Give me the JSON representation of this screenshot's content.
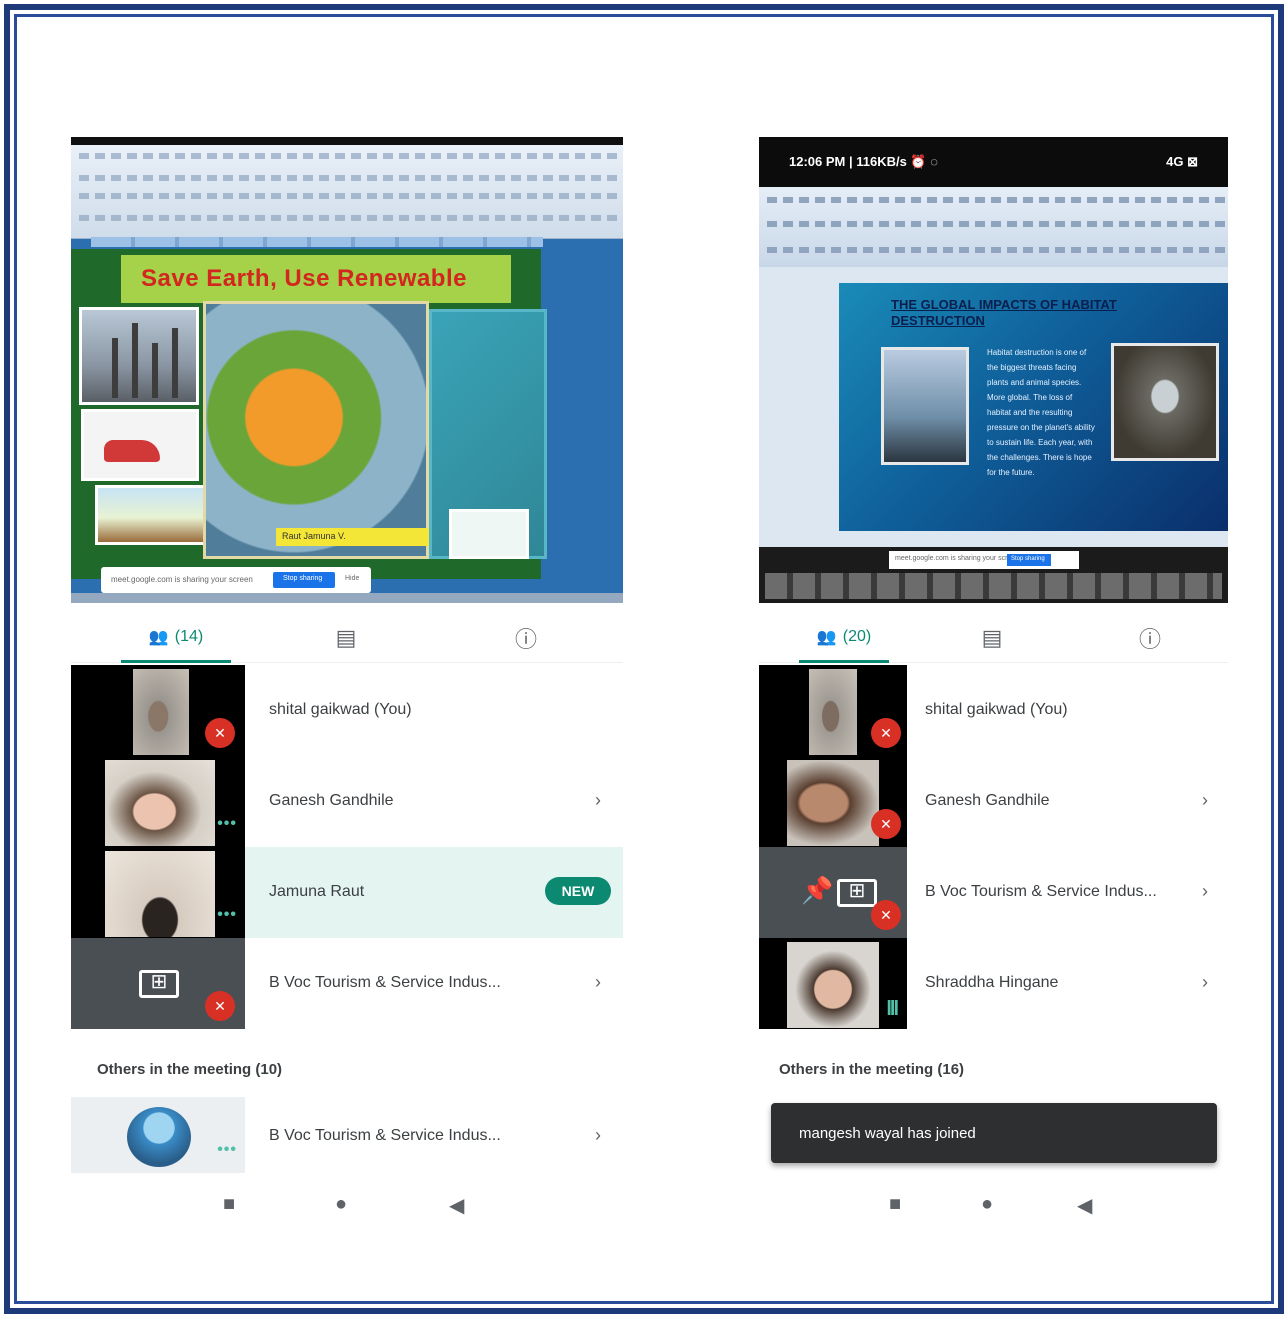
{
  "left_phone": {
    "slide_title": "Save Earth, Use  Renewable",
    "slide_caption": "Raut Jamuna V.",
    "share_bar_text": "meet.google.com is sharing your screen",
    "share_bar_button": "Stop sharing",
    "share_bar_hide": "Hide",
    "tabs": {
      "people_count": "(14)"
    },
    "participants": [
      {
        "name": "shital gaikwad (You)"
      },
      {
        "name": "Ganesh Gandhile"
      },
      {
        "name": "Jamuna Raut",
        "badge": "NEW"
      },
      {
        "name": "B Voc Tourism & Service Indus..."
      }
    ],
    "others_heading": "Others in the meeting (10)",
    "others": [
      {
        "name": "B Voc Tourism & Service Indus..."
      }
    ]
  },
  "right_phone": {
    "status_time": "12:06 PM | 116KB/s ⏰ ◌",
    "status_right": "4G  ⊠",
    "slide_title": "THE GLOBAL IMPACTS OF HABITAT DESTRUCTION",
    "slide_body": "Habitat destruction is one of the biggest threats facing plants and animal species. More global. The loss of habitat and the resulting pressure on the planet's ability to sustain life. Each year, with the challenges. There is hope for the future.",
    "share_bar_text": "meet.google.com is sharing your screen",
    "share_bar_button": "Stop sharing",
    "tabs": {
      "people_count": "(20)"
    },
    "participants": [
      {
        "name": "shital gaikwad (You)"
      },
      {
        "name": "Ganesh Gandhile"
      },
      {
        "name": "B Voc Tourism & Service Indus..."
      },
      {
        "name": "Shraddha Hingane"
      }
    ],
    "others_heading": "Others in the meeting (16)",
    "toast": "mangesh wayal has joined"
  },
  "icons": {
    "people": "👥",
    "chat": "▤",
    "info": "ⓘ",
    "chevron": "›",
    "share": "⊞",
    "pin": "📌",
    "mic_off": "✕",
    "dots": "•••",
    "level": "lll",
    "nav_square": "■",
    "nav_circle": "●",
    "nav_back": "◀"
  },
  "colors": {
    "accent": "#0b8a71",
    "mic_off": "#d93025",
    "frame": "#1f3a7a"
  }
}
